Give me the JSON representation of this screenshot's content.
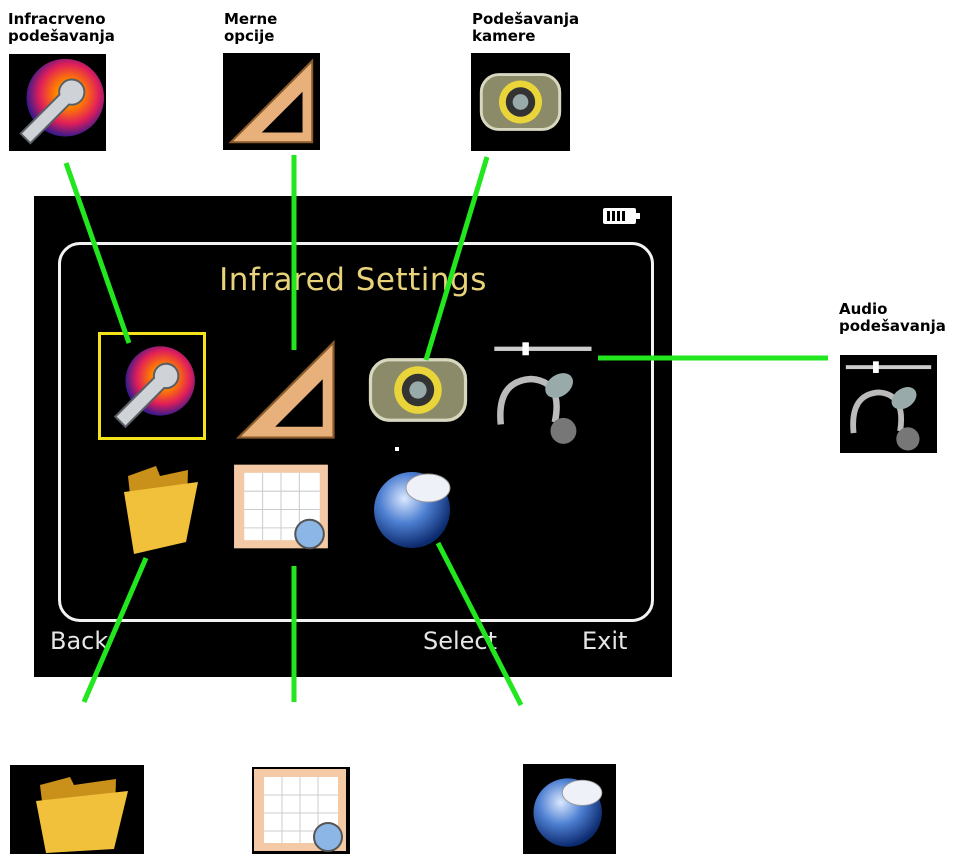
{
  "callouts": {
    "infrared": "Infracrveno\npodešavanja",
    "measure": "Merne\nopcije",
    "camera": "Podešavanja\nkamere",
    "audio": "Audio\npodešavanja"
  },
  "screen": {
    "title": "Infrared Settings",
    "softkeys": {
      "back": "Back",
      "select": "Select",
      "exit": "Exit"
    }
  },
  "icons": [
    "infrared-settings-icon",
    "measurement-options-icon",
    "camera-settings-icon",
    "audio-settings-icon",
    "folder-icon",
    "calendar-clock-icon",
    "globe-language-icon",
    "battery-icon"
  ],
  "colors": {
    "connector": "#22e61e",
    "selection": "#f4e31a",
    "title": "#e8d27a"
  }
}
